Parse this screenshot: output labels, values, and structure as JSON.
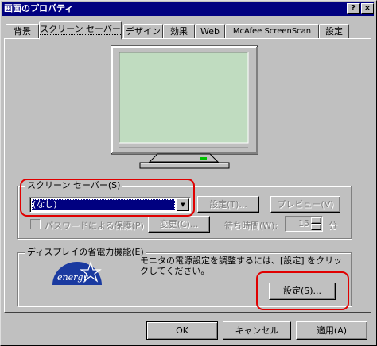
{
  "window": {
    "title": "画面のプロパティ",
    "help_glyph": "?",
    "close_glyph": "×"
  },
  "tabs": [
    {
      "label": "背景"
    },
    {
      "label": "スクリーン セーバー",
      "active": true
    },
    {
      "label": "デザイン"
    },
    {
      "label": "効果"
    },
    {
      "label": "Web"
    },
    {
      "label": "McAfee ScreenScan"
    },
    {
      "label": "設定"
    }
  ],
  "screensaver": {
    "group_label": "スクリーン セーバー(S)",
    "selected_value": "(なし)",
    "dropdown_glyph": "▼",
    "settings_button": "設定(T)...",
    "preview_button": "プレビュー(V)",
    "password_label": "パスワードによる保護(P)",
    "change_button": "変更(C)...",
    "wait_label": "待ち時間(W):",
    "wait_value": "15",
    "wait_unit": "分",
    "enabled": false
  },
  "power": {
    "group_label": "ディスプレイの省電力機能(E)",
    "description": "モニタの電源設定を調整するには、[設定] をクリックしてください。",
    "settings_button": "設定(S)...",
    "logo_text": "energy"
  },
  "footer": {
    "ok": "OK",
    "cancel": "キャンセル",
    "apply": "適用(A)"
  },
  "colors": {
    "titlebar": "#000080",
    "selection": "#000080",
    "monitor_screen": "#c0dcc0",
    "highlight_box": "#e00000"
  }
}
